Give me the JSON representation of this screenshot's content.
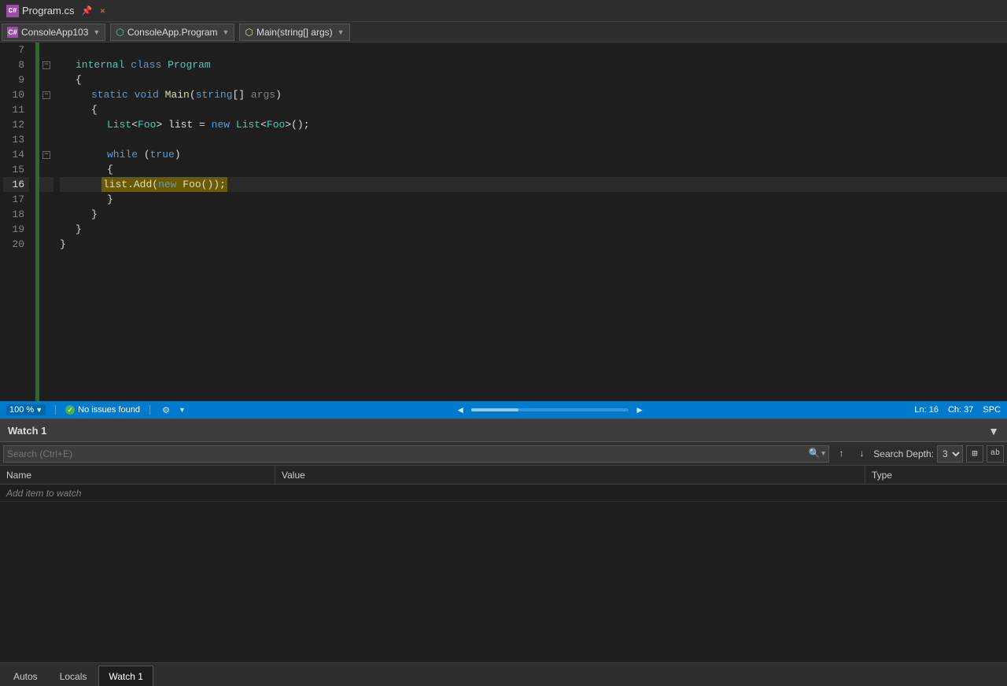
{
  "titleBar": {
    "filename": "Program.cs",
    "icons": [
      "pin",
      "close"
    ]
  },
  "navBar": {
    "projectIcon": "C#",
    "projectName": "ConsoleApp103",
    "namespace": "ConsoleApp.Program",
    "method": "Main(string[] args)"
  },
  "editor": {
    "lines": [
      {
        "num": 7,
        "content": "",
        "tokens": []
      },
      {
        "num": 8,
        "content": "    internal class Program",
        "tokens": [
          {
            "text": "    ",
            "cls": "plain"
          },
          {
            "text": "internal",
            "cls": "kw-internal"
          },
          {
            "text": " ",
            "cls": "plain"
          },
          {
            "text": "class",
            "cls": "kw"
          },
          {
            "text": " ",
            "cls": "plain"
          },
          {
            "text": "Program",
            "cls": "class-name"
          }
        ],
        "hasCollapse": true,
        "indent": 1
      },
      {
        "num": 9,
        "content": "    {",
        "tokens": [
          {
            "text": "    {",
            "cls": "plain"
          }
        ]
      },
      {
        "num": 10,
        "content": "        static void Main(string[] args)",
        "tokens": [
          {
            "text": "        ",
            "cls": "plain"
          },
          {
            "text": "static",
            "cls": "kw"
          },
          {
            "text": " ",
            "cls": "plain"
          },
          {
            "text": "void",
            "cls": "kw"
          },
          {
            "text": " ",
            "cls": "plain"
          },
          {
            "text": "Main",
            "cls": "method"
          },
          {
            "text": "(",
            "cls": "plain"
          },
          {
            "text": "string",
            "cls": "kw"
          },
          {
            "text": "[]",
            "cls": "plain"
          },
          {
            "text": " args",
            "cls": "faded"
          },
          {
            "text": ")",
            "cls": "plain"
          }
        ],
        "hasCollapse": true,
        "indent": 2
      },
      {
        "num": 11,
        "content": "        {",
        "tokens": [
          {
            "text": "        {",
            "cls": "plain"
          }
        ]
      },
      {
        "num": 12,
        "content": "            List<Foo> list = new List<Foo>();",
        "tokens": [
          {
            "text": "            ",
            "cls": "plain"
          },
          {
            "text": "List",
            "cls": "class-name"
          },
          {
            "text": "<",
            "cls": "plain"
          },
          {
            "text": "Foo",
            "cls": "class-name"
          },
          {
            "text": "> list = ",
            "cls": "plain"
          },
          {
            "text": "new",
            "cls": "kw"
          },
          {
            "text": " ",
            "cls": "plain"
          },
          {
            "text": "List",
            "cls": "class-name"
          },
          {
            "text": "<",
            "cls": "plain"
          },
          {
            "text": "Foo",
            "cls": "class-name"
          },
          {
            "text": ">();",
            "cls": "plain"
          }
        ]
      },
      {
        "num": 13,
        "content": "",
        "tokens": []
      },
      {
        "num": 14,
        "content": "            while (true)",
        "tokens": [
          {
            "text": "            ",
            "cls": "plain"
          },
          {
            "text": "while",
            "cls": "kw"
          },
          {
            "text": " (",
            "cls": "plain"
          },
          {
            "text": "true",
            "cls": "kw"
          },
          {
            "text": ")",
            "cls": "plain"
          }
        ],
        "hasCollapse": true,
        "indent": 3
      },
      {
        "num": 15,
        "content": "            {",
        "tokens": [
          {
            "text": "            {",
            "cls": "plain"
          }
        ]
      },
      {
        "num": 16,
        "content": "                list.Add(new Foo());",
        "tokens": [
          {
            "text": "                ",
            "cls": "plain"
          },
          {
            "text": "list",
            "cls": "plain"
          },
          {
            "text": ".Add(",
            "cls": "plain"
          },
          {
            "text": "new",
            "cls": "kw"
          },
          {
            "text": " Foo());",
            "cls": "plain"
          }
        ],
        "isCurrentLine": true,
        "highlighted": true,
        "hasArrow": true
      },
      {
        "num": 17,
        "content": "            }",
        "tokens": [
          {
            "text": "            }",
            "cls": "plain"
          }
        ]
      },
      {
        "num": 18,
        "content": "        }",
        "tokens": [
          {
            "text": "        }",
            "cls": "plain"
          }
        ]
      },
      {
        "num": 19,
        "content": "    }",
        "tokens": [
          {
            "text": "    }",
            "cls": "plain"
          }
        ]
      },
      {
        "num": 20,
        "content": "}",
        "tokens": [
          {
            "text": "}",
            "cls": "plain"
          }
        ]
      }
    ]
  },
  "statusBar": {
    "zoom": "100 %",
    "diagnosticsIcon": "gear",
    "issuesStatus": "No issues found",
    "leftArrow": "◄",
    "rightArrow": "►",
    "lineInfo": "Ln: 16",
    "colInfo": "Ch: 37",
    "encodingInfo": "SPC"
  },
  "watchPanel": {
    "title": "Watch 1",
    "searchPlaceholder": "Search (Ctrl+E)",
    "searchDepthLabel": "Search Depth:",
    "searchDepthValue": "3",
    "columns": {
      "name": "Name",
      "value": "Value",
      "type": "Type"
    },
    "addItemText": "Add item to watch"
  },
  "bottomTabs": [
    {
      "label": "Autos",
      "active": false
    },
    {
      "label": "Locals",
      "active": false
    },
    {
      "label": "Watch 1",
      "active": true
    }
  ]
}
